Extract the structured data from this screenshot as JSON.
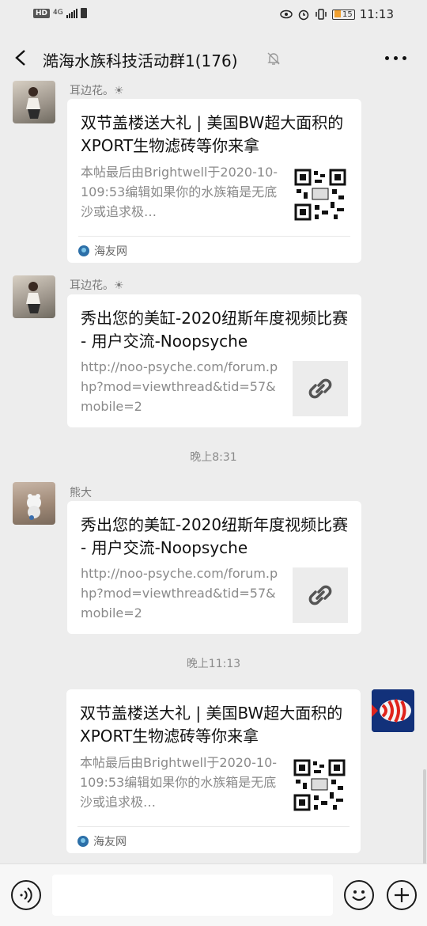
{
  "status_bar": {
    "hd_label": "HD",
    "network": "4G",
    "time": "11:13",
    "battery_level": "15"
  },
  "header": {
    "title": "澔海水族科技活动群1(176)"
  },
  "messages": [
    {
      "sender": "耳边花。☀",
      "card": {
        "title": "双节盖楼送大礼 | 美国BW超大面积的XPORT生物滤砖等你来拿",
        "description": "本帖最后由Brightwell于2020-10-109:53编辑如果你的水族箱是无底沙或追求极…",
        "thumbnail": "qr-code-icon",
        "source": "海友网"
      }
    },
    {
      "sender": "耳边花。☀",
      "card": {
        "title": "秀出您的美缸-2020纽斯年度视频比赛 - 用户交流-Noopsyche",
        "description": "http://noo-psyche.com/forum.php?mod=viewthread&tid=57&mobile=2",
        "thumbnail": "link-icon"
      }
    },
    {
      "time_divider": "晚上8:31"
    },
    {
      "sender": "熊大",
      "card": {
        "title": "秀出您的美缸-2020纽斯年度视频比赛 - 用户交流-Noopsyche",
        "description": "http://noo-psyche.com/forum.php?mod=viewthread&tid=57&mobile=2",
        "thumbnail": "link-icon"
      }
    },
    {
      "time_divider": "晚上11:13"
    },
    {
      "sender": "",
      "card": {
        "title": "双节盖楼送大礼 | 美国BW超大面积的XPORT生物滤砖等你来拿",
        "description": "本帖最后由Brightwell于2020-10-109:53编辑如果你的水族箱是无底沙或追求极…",
        "thumbnail": "qr-code-icon",
        "source": "海友网"
      }
    }
  ],
  "input_bar": {
    "text_value": ""
  },
  "colors": {
    "background": "#ededed",
    "card": "#ffffff",
    "meta_text": "#8a8a8a"
  }
}
